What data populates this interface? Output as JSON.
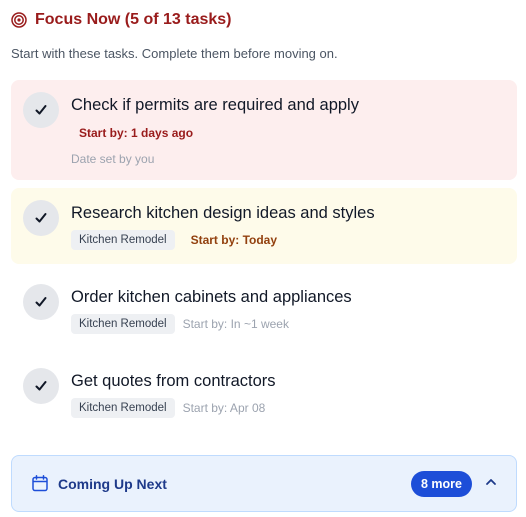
{
  "header": {
    "title": "Focus Now (5 of 13 tasks)",
    "subtitle": "Start with these tasks. Complete them before moving on."
  },
  "tasks": [
    {
      "title": "Check if permits are required and apply",
      "start": "Start by: 1 days ago",
      "note": "Date set by you",
      "status": "overdue"
    },
    {
      "title": "Research kitchen design ideas and styles",
      "tag": "Kitchen Remodel",
      "start": "Start by: Today",
      "status": "today"
    },
    {
      "title": "Order kitchen cabinets and appliances",
      "tag": "Kitchen Remodel",
      "start": "Start by: In ~1 week",
      "status": "upcoming"
    },
    {
      "title": "Get quotes from contractors",
      "tag": "Kitchen Remodel",
      "start": "Start by: Apr 08",
      "status": "upcoming"
    }
  ],
  "coming_up": {
    "label": "Coming Up Next",
    "badge": "8 more"
  },
  "colors": {
    "accent_red": "#991b1b",
    "accent_blue": "#1d4ed8",
    "overdue_bg": "#fdeeee",
    "today_bg": "#fefbea"
  },
  "icons": {
    "header": "target-icon",
    "check": "checkmark-icon",
    "coming_up": "calendar-icon",
    "toggle": "chevron-up-icon"
  }
}
